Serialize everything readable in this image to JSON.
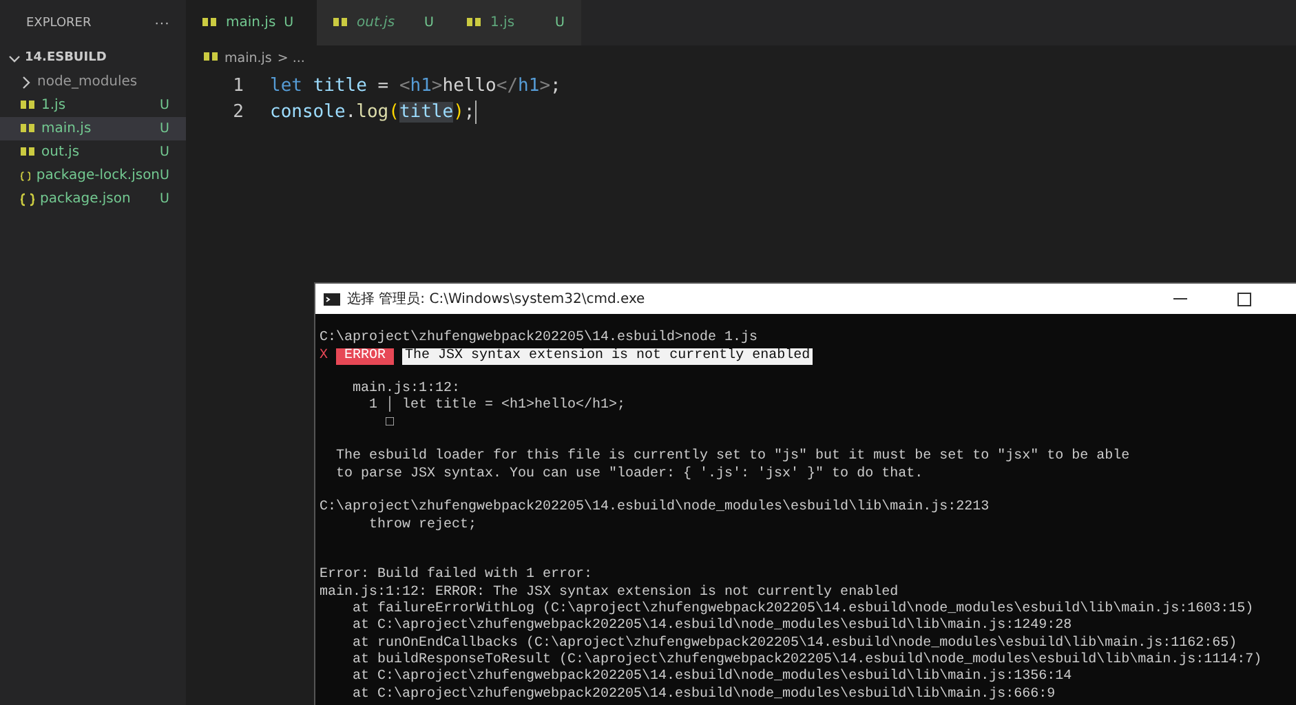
{
  "sidebar": {
    "title": "EXPLORER",
    "more": "···",
    "project": {
      "label": "14.ESBUILD",
      "expanded": true
    },
    "items": [
      {
        "kind": "folder",
        "name": "node_modules",
        "expanded": false,
        "selected": false
      },
      {
        "kind": "js",
        "name": "1.js",
        "status": "U",
        "selected": false
      },
      {
        "kind": "js",
        "name": "main.js",
        "status": "U",
        "selected": true
      },
      {
        "kind": "js",
        "name": "out.js",
        "status": "U",
        "selected": false
      },
      {
        "kind": "json",
        "name": "package-lock.json",
        "status": "U",
        "selected": false
      },
      {
        "kind": "json",
        "name": "package.json",
        "status": "U",
        "selected": false
      }
    ]
  },
  "tabs": [
    {
      "label": "main.js",
      "status": "U",
      "selected": true,
      "preview": false
    },
    {
      "label": "out.js",
      "status": "U",
      "selected": false,
      "preview": true
    },
    {
      "label": "1.js",
      "status": "U",
      "selected": false,
      "preview": false
    }
  ],
  "breadcrumb": {
    "file": "main.js",
    "rest": "> ..."
  },
  "code": [
    {
      "number": "1",
      "tokens": [
        {
          "kind": "keyword",
          "text": "let "
        },
        {
          "kind": "variable",
          "text": "title"
        },
        {
          "kind": "plain",
          "text": " = "
        },
        {
          "kind": "bracket",
          "text": "<"
        },
        {
          "kind": "keyword",
          "text": "h1"
        },
        {
          "kind": "bracket",
          "text": ">"
        },
        {
          "kind": "plain",
          "text": "hello"
        },
        {
          "kind": "bracket",
          "text": "</"
        },
        {
          "kind": "keyword",
          "text": "h1"
        },
        {
          "kind": "bracket",
          "text": ">"
        },
        {
          "kind": "plain",
          "text": ";"
        }
      ]
    },
    {
      "number": "2",
      "tokens": [
        {
          "kind": "variable",
          "text": "console"
        },
        {
          "kind": "plain",
          "text": "."
        },
        {
          "kind": "function",
          "text": "log"
        },
        {
          "kind": "paren",
          "text": "("
        },
        {
          "kind": "variable",
          "text": "title",
          "highlighted": true
        },
        {
          "kind": "paren",
          "text": ")"
        },
        {
          "kind": "plain",
          "text": ";"
        }
      ]
    }
  ],
  "terminal": {
    "title": "选择 管理员: C:\\Windows\\system32\\cmd.exe",
    "lines": [
      {
        "kind": "blank"
      },
      {
        "kind": "text",
        "text": "C:\\aproject\\zhufengwebpack202205\\14.esbuild>node 1.js"
      },
      {
        "kind": "error",
        "mark": "X",
        "badge": "ERROR",
        "text": "The JSX syntax extension is not currently enabled"
      },
      {
        "kind": "blank"
      },
      {
        "kind": "text",
        "text": "    main.js:1:12:"
      },
      {
        "kind": "text",
        "text": "      1 │ let title = <h1>hello</h1>;"
      },
      {
        "kind": "text",
        "text": "        □"
      },
      {
        "kind": "blank"
      },
      {
        "kind": "text",
        "text": "  The esbuild loader for this file is currently set to \"js\" but it must be set to \"jsx\" to be able"
      },
      {
        "kind": "text",
        "text": "  to parse JSX syntax. You can use \"loader: { '.js': 'jsx' }\" to do that."
      },
      {
        "kind": "blank"
      },
      {
        "kind": "text",
        "text": "C:\\aproject\\zhufengwebpack202205\\14.esbuild\\node_modules\\esbuild\\lib\\main.js:2213"
      },
      {
        "kind": "text",
        "text": "      throw reject;"
      },
      {
        "kind": "blank"
      },
      {
        "kind": "blank"
      },
      {
        "kind": "text",
        "text": "Error: Build failed with 1 error:"
      },
      {
        "kind": "text",
        "text": "main.js:1:12: ERROR: The JSX syntax extension is not currently enabled"
      },
      {
        "kind": "text",
        "text": "    at failureErrorWithLog (C:\\aproject\\zhufengwebpack202205\\14.esbuild\\node_modules\\esbuild\\lib\\main.js:1603:15)"
      },
      {
        "kind": "text",
        "text": "    at C:\\aproject\\zhufengwebpack202205\\14.esbuild\\node_modules\\esbuild\\lib\\main.js:1249:28"
      },
      {
        "kind": "text",
        "text": "    at runOnEndCallbacks (C:\\aproject\\zhufengwebpack202205\\14.esbuild\\node_modules\\esbuild\\lib\\main.js:1162:65)"
      },
      {
        "kind": "text",
        "text": "    at buildResponseToResult (C:\\aproject\\zhufengwebpack202205\\14.esbuild\\node_modules\\esbuild\\lib\\main.js:1114:7)"
      },
      {
        "kind": "text",
        "text": "    at C:\\aproject\\zhufengwebpack202205\\14.esbuild\\node_modules\\esbuild\\lib\\main.js:1356:14"
      },
      {
        "kind": "text",
        "text": "    at C:\\aproject\\zhufengwebpack202205\\14.esbuild\\node_modules\\esbuild\\lib\\main.js:666:9"
      }
    ]
  }
}
